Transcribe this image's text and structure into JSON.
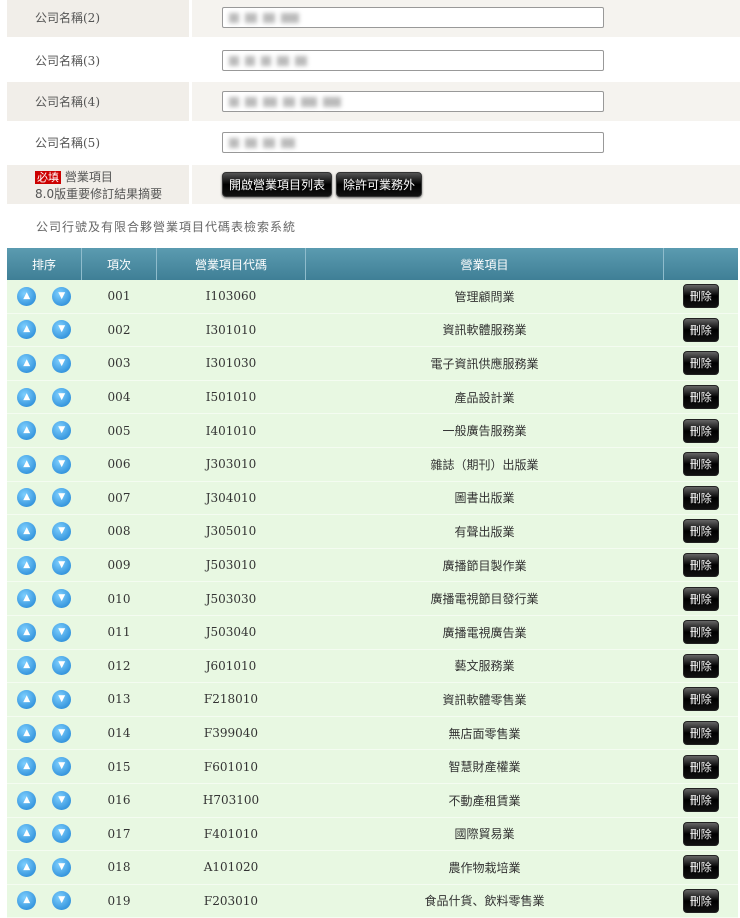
{
  "company_names": [
    {
      "label": "公司名稱(2)"
    },
    {
      "label": "公司名稱(3)"
    },
    {
      "label": "公司名稱(4)"
    },
    {
      "label": "公司名稱(5)"
    }
  ],
  "business": {
    "required": "必填",
    "label": "營業項目",
    "sub": "8.0版重要修訂結果摘要",
    "open_list_button": "開啟營業項目列表",
    "exclude_button": "除許可業務外"
  },
  "caption": "公司行號及有限合夥營業項目代碼表檢索系統",
  "table": {
    "headers": [
      "排序",
      "項次",
      "營業項目代碼",
      "營業項目",
      ""
    ],
    "delete_label": "刪除",
    "rows": [
      [
        "001",
        "I103060",
        "管理顧問業"
      ],
      [
        "002",
        "I301010",
        "資訊軟體服務業"
      ],
      [
        "003",
        "I301030",
        "電子資訊供應服務業"
      ],
      [
        "004",
        "I501010",
        "產品設計業"
      ],
      [
        "005",
        "I401010",
        "一般廣告服務業"
      ],
      [
        "006",
        "J303010",
        "雜誌（期刊）出版業"
      ],
      [
        "007",
        "J304010",
        "圖書出版業"
      ],
      [
        "008",
        "J305010",
        "有聲出版業"
      ],
      [
        "009",
        "J503010",
        "廣播節目製作業"
      ],
      [
        "010",
        "J503030",
        "廣播電視節目發行業"
      ],
      [
        "011",
        "J503040",
        "廣播電視廣告業"
      ],
      [
        "012",
        "J601010",
        "藝文服務業"
      ],
      [
        "013",
        "F218010",
        "資訊軟體零售業"
      ],
      [
        "014",
        "F399040",
        "無店面零售業"
      ],
      [
        "015",
        "F601010",
        "智慧財產權業"
      ],
      [
        "016",
        "H703100",
        "不動產租賃業"
      ],
      [
        "017",
        "F401010",
        "國際貿易業"
      ],
      [
        "018",
        "A101020",
        "農作物栽培業"
      ],
      [
        "019",
        "F203010",
        "食品什貨、飲料零售業"
      ]
    ]
  }
}
